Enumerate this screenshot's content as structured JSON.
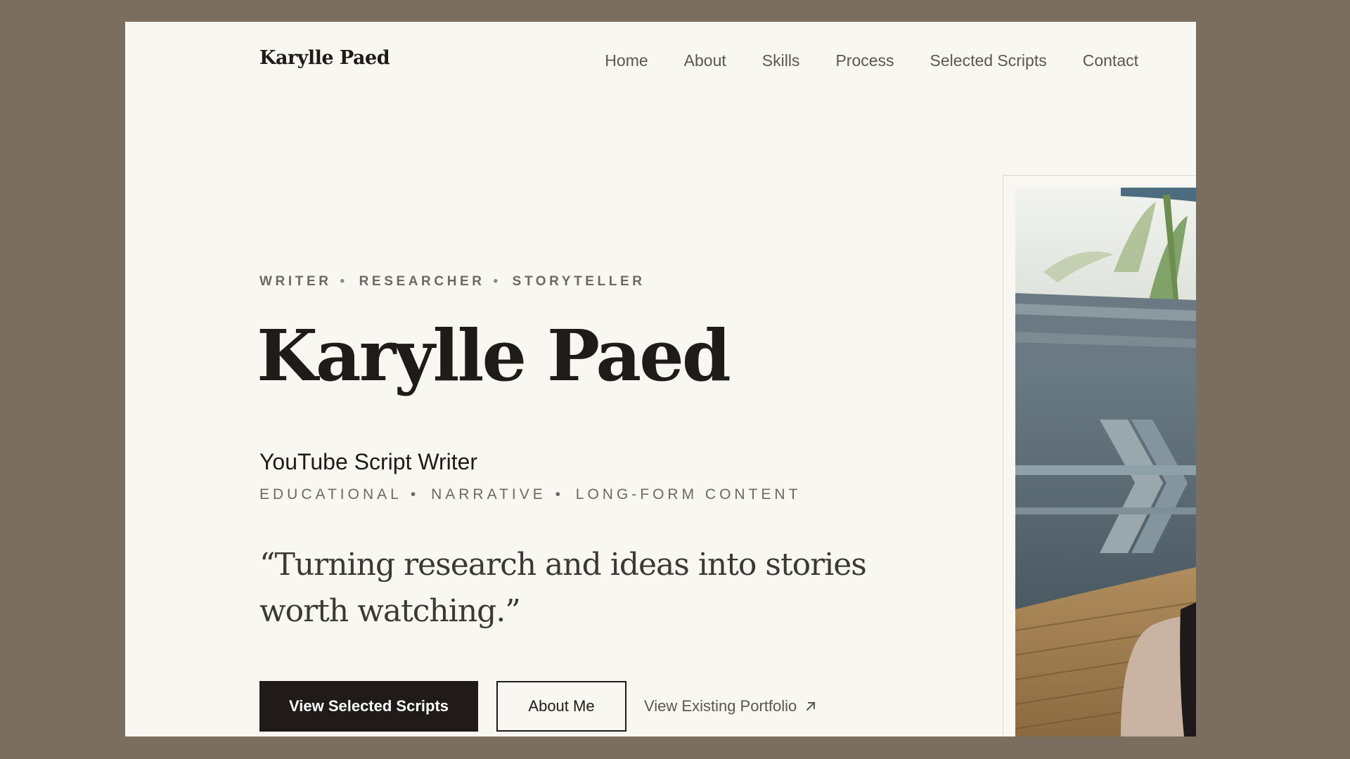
{
  "header": {
    "brand": "Karylle Paed",
    "nav": [
      "Home",
      "About",
      "Skills",
      "Process",
      "Selected Scripts",
      "Contact"
    ]
  },
  "hero": {
    "eyebrow": [
      "WRITER",
      "RESEARCHER",
      "STORYTELLER"
    ],
    "eyebrow_separator": "•",
    "name": "Karylle Paed",
    "role": "YouTube Script Writer",
    "categories": [
      "EDUCATIONAL",
      "NARRATIVE",
      "LONG-FORM CONTENT"
    ],
    "categories_separator": "•",
    "quote": "“Turning research and ideas into stories worth watching.”",
    "buttons": {
      "primary": "View Selected Scripts",
      "secondary": "About Me",
      "link": "View Existing Portfolio"
    }
  },
  "photo": {
    "alt_icon": "portrait-photo"
  },
  "colors": {
    "page_background": "#7b6e5e",
    "surface": "#f9f7f1",
    "ink": "#1f1b18",
    "muted": "#6e6861"
  }
}
